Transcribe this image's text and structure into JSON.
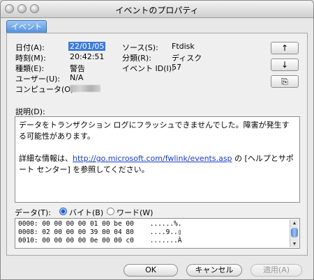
{
  "window": {
    "title": "イベントのプロパティ"
  },
  "tabs": [
    {
      "label": "イベント"
    }
  ],
  "fields": {
    "date": {
      "label": "日付(A):",
      "value": "22/01/05"
    },
    "time": {
      "label": "時刻(M):",
      "value": "20:42:51"
    },
    "type": {
      "label": "種類(E):",
      "value": "警告"
    },
    "user": {
      "label": "ユーザー(U):",
      "value": "N/A"
    },
    "computer": {
      "label": "コンピュータ(O):"
    },
    "source": {
      "label": "ソース(S):",
      "value": "Ftdisk"
    },
    "category": {
      "label": "分類(R):",
      "value": "ディスク"
    },
    "event_id": {
      "label": "イベント ID(I):",
      "value": "57"
    }
  },
  "nav_buttons": {
    "up": "↑",
    "down": "↓",
    "copy": "⎘"
  },
  "description": {
    "label": "説明(D):",
    "line1": "データをトランザクション ログにフラッシュできませんでした。障害が発生する可能性があります。",
    "line2_prefix": "詳細な情報は、",
    "link": "http://go.microsoft.com/fwlink/events.asp",
    "line2_suffix": " の [ヘルプとサポート センター] を参照してください。"
  },
  "data": {
    "label": "データ(T):",
    "radio_bytes": "バイト(B)",
    "radio_words": "ワード(W)",
    "rows": [
      "0000: 00 00 00 00 01 00 be 00    ......%.",
      "0008: 02 00 00 00 39 00 04 80    ....9..▯",
      "0010: 00 00 00 00 0e 00 00 c0    .......À"
    ]
  },
  "buttons": {
    "ok": "OK",
    "cancel": "キャンセル",
    "apply": "適用(A)"
  }
}
